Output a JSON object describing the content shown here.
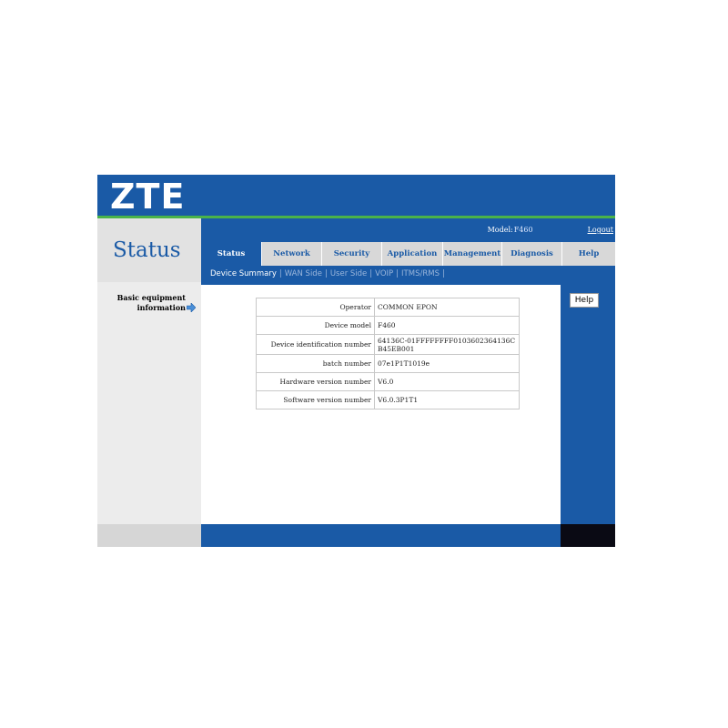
{
  "header": {
    "logo": "ZTE"
  },
  "page": {
    "title": "Status"
  },
  "topbar": {
    "model_label": "Model:",
    "model_value": "F460",
    "logout": "Logout"
  },
  "tabs": [
    {
      "label": "Status"
    },
    {
      "label": "Network"
    },
    {
      "label": "Security"
    },
    {
      "label": "Application"
    },
    {
      "label": "Management"
    },
    {
      "label": "Diagnosis"
    },
    {
      "label": "Help"
    }
  ],
  "subnav": [
    {
      "label": "Device Summary"
    },
    {
      "label": "WAN Side"
    },
    {
      "label": "User Side"
    },
    {
      "label": "VOIP"
    },
    {
      "label": "ITMS/RMS"
    }
  ],
  "left_nav": {
    "item": "Basic equipment information",
    "icon": "arrow-right-icon"
  },
  "info_table": [
    {
      "label": "Operator",
      "value": "COMMON EPON"
    },
    {
      "label": "Device model",
      "value": "F460"
    },
    {
      "label": "Device identification number",
      "value": "64136C-01FFFFFFFF0103602364136CB45EB001"
    },
    {
      "label": "batch number",
      "value": "07e1P1T1019e"
    },
    {
      "label": "Hardware version number",
      "value": "V6.0"
    },
    {
      "label": "Software version number",
      "value": "V6.0.3P1T1"
    }
  ],
  "help_button": "Help",
  "colors": {
    "brand_blue": "#1a5aa6",
    "accent_green": "#4ab34a",
    "panel_gray": "#e2e2e2"
  }
}
